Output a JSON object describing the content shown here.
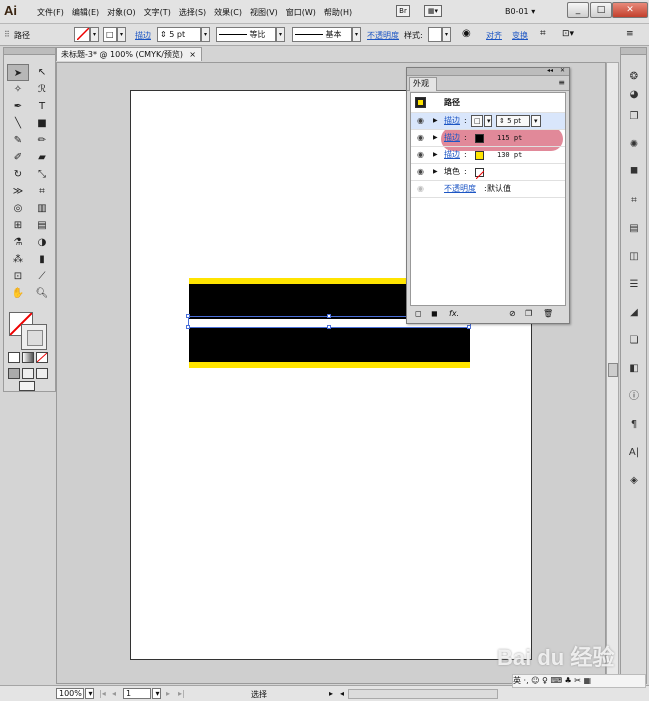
{
  "app": {
    "logo": "Ai",
    "workspace": "B0-01",
    "workspace_arrow": "▾"
  },
  "menu": [
    "文件(F)",
    "编辑(E)",
    "对象(O)",
    "文字(T)",
    "选择(S)",
    "效果(C)",
    "视图(V)",
    "窗口(W)",
    "帮助(H)"
  ],
  "window_buttons": {
    "min": "_",
    "max": "□",
    "close": "✕"
  },
  "control_bar": {
    "object_type": "路径",
    "stroke_label": "描边",
    "stroke_weight": "5 pt",
    "stroke_profile": "等比",
    "brush": "基本",
    "opacity_label": "不透明度",
    "style_label": "样式:",
    "align_label": "对齐",
    "transform_label": "变换"
  },
  "document_tab": {
    "title": "未标题-3* @ 100% (CMYK/预览)",
    "close": "×"
  },
  "appearance_panel": {
    "tab": "外观",
    "title": "路径",
    "rows": [
      {
        "label": "描边",
        "value": "5 pt",
        "swatch": "#f0f0f0",
        "highlight": true
      },
      {
        "label": "描边",
        "value": "115 pt",
        "swatch": "#000000"
      },
      {
        "label": "描边",
        "value": "130 pt",
        "swatch": "#ffe400"
      },
      {
        "label": "填色",
        "value": "",
        "swatch": "none"
      },
      {
        "label": "不透明度",
        "value": "默认值"
      }
    ],
    "footer_fx": "fx."
  },
  "status_bar": {
    "zoom": "100%",
    "page": "1",
    "tool": "选择"
  },
  "watermark": "Bai du 经验",
  "tray": "英 ·, ☺ ♀ ⌨ ♣ ✂ ▦"
}
